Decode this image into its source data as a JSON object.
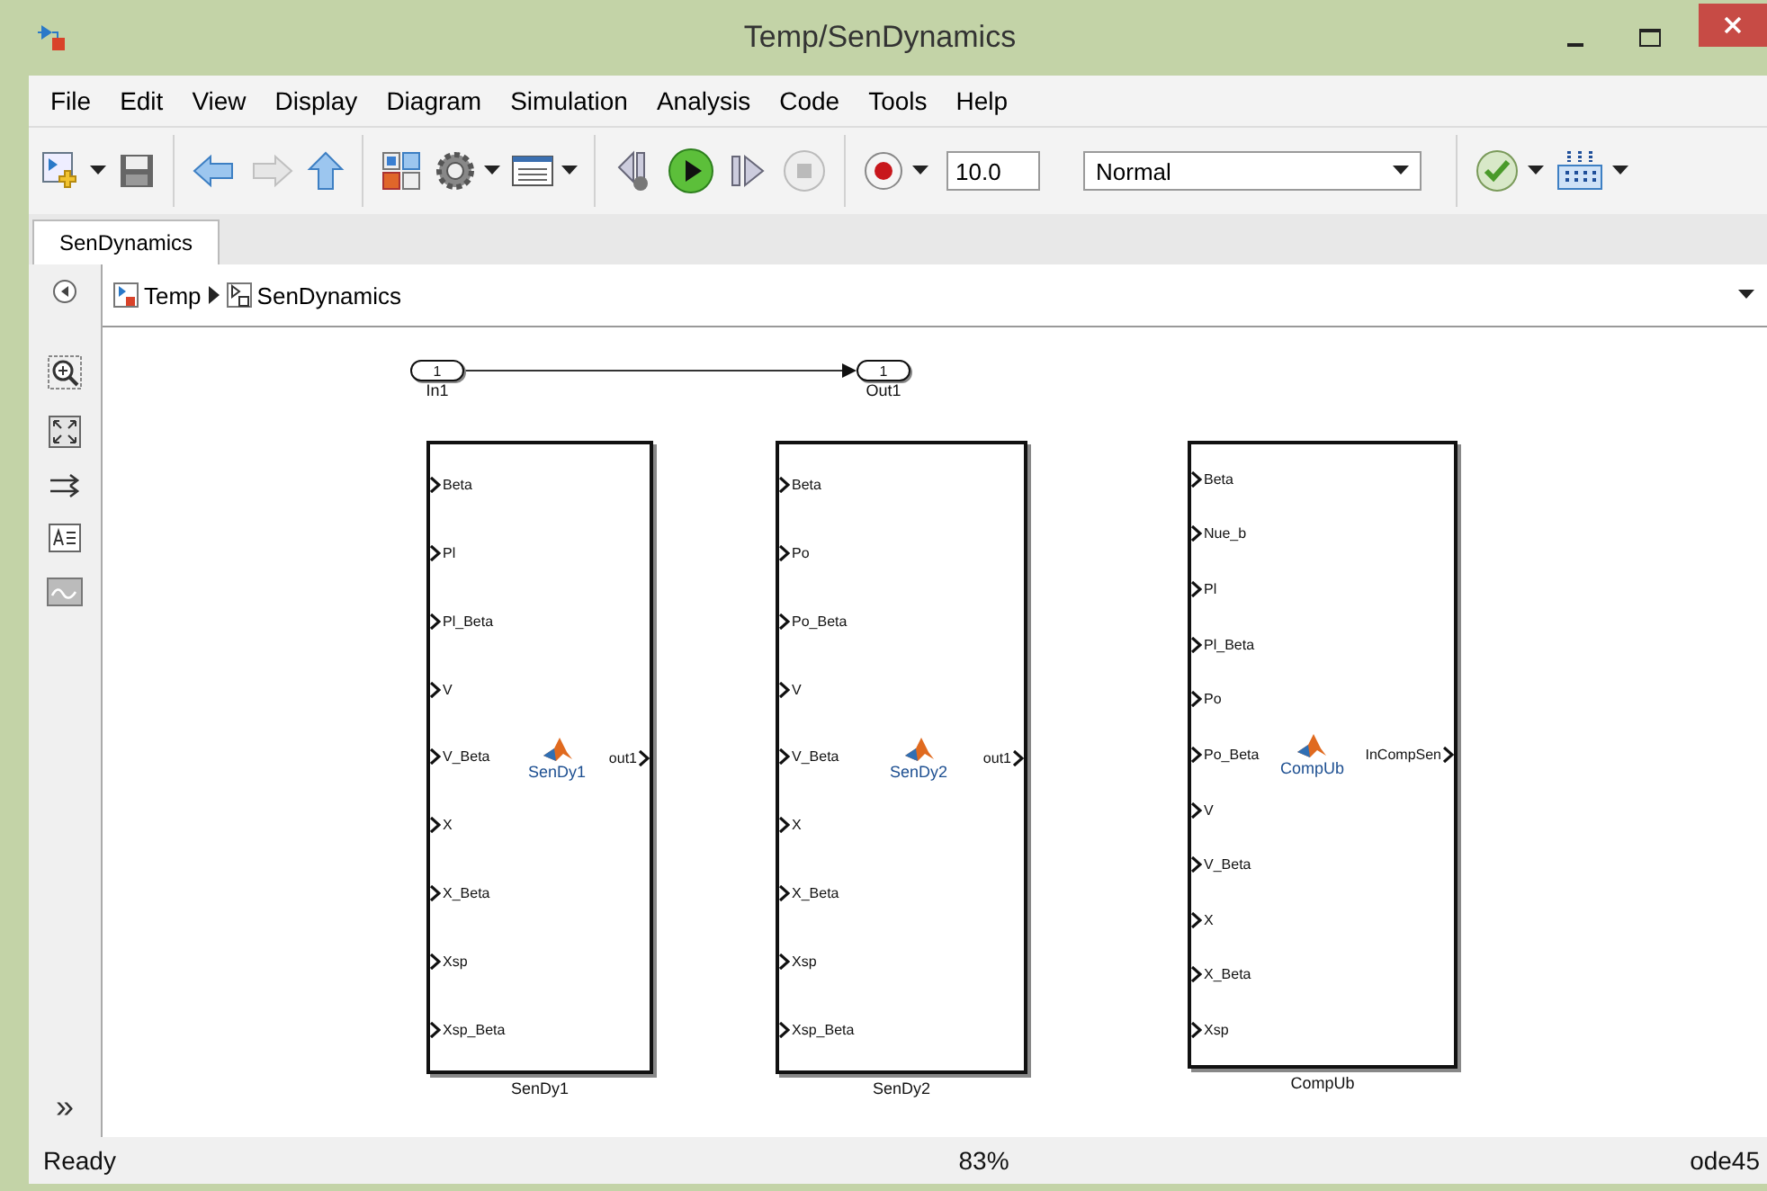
{
  "window": {
    "title": "Temp/SenDynamics"
  },
  "menu": [
    "File",
    "Edit",
    "View",
    "Display",
    "Diagram",
    "Simulation",
    "Analysis",
    "Code",
    "Tools",
    "Help"
  ],
  "toolbar": {
    "stop_time": "10.0",
    "mode": "Normal"
  },
  "tabs": [
    {
      "label": "SenDynamics",
      "selected": true
    }
  ],
  "breadcrumb": [
    "Temp",
    "SenDynamics"
  ],
  "palette_more": "»",
  "diagram": {
    "ports": [
      {
        "number": "1",
        "label": "In1"
      },
      {
        "number": "1",
        "label": "Out1"
      }
    ],
    "blocks": [
      {
        "icon_label": "SenDy1",
        "name": "SenDy1",
        "inputs": [
          "Beta",
          "Pl",
          "Pl_Beta",
          "V",
          "V_Beta",
          "X",
          "X_Beta",
          "Xsp",
          "Xsp_Beta"
        ],
        "output": "out1"
      },
      {
        "icon_label": "SenDy2",
        "name": "SenDy2",
        "inputs": [
          "Beta",
          "Po",
          "Po_Beta",
          "V",
          "V_Beta",
          "X",
          "X_Beta",
          "Xsp",
          "Xsp_Beta"
        ],
        "output": "out1"
      },
      {
        "icon_label": "CompUb",
        "name": "CompUb",
        "inputs": [
          "Beta",
          "Nue_b",
          "Pl",
          "Pl_Beta",
          "Po",
          "Po_Beta",
          "V",
          "V_Beta",
          "X",
          "X_Beta",
          "Xsp"
        ],
        "output": "InCompSen"
      }
    ]
  },
  "status_bar": {
    "state": "Ready",
    "zoom": "83%",
    "solver": "ode45"
  }
}
